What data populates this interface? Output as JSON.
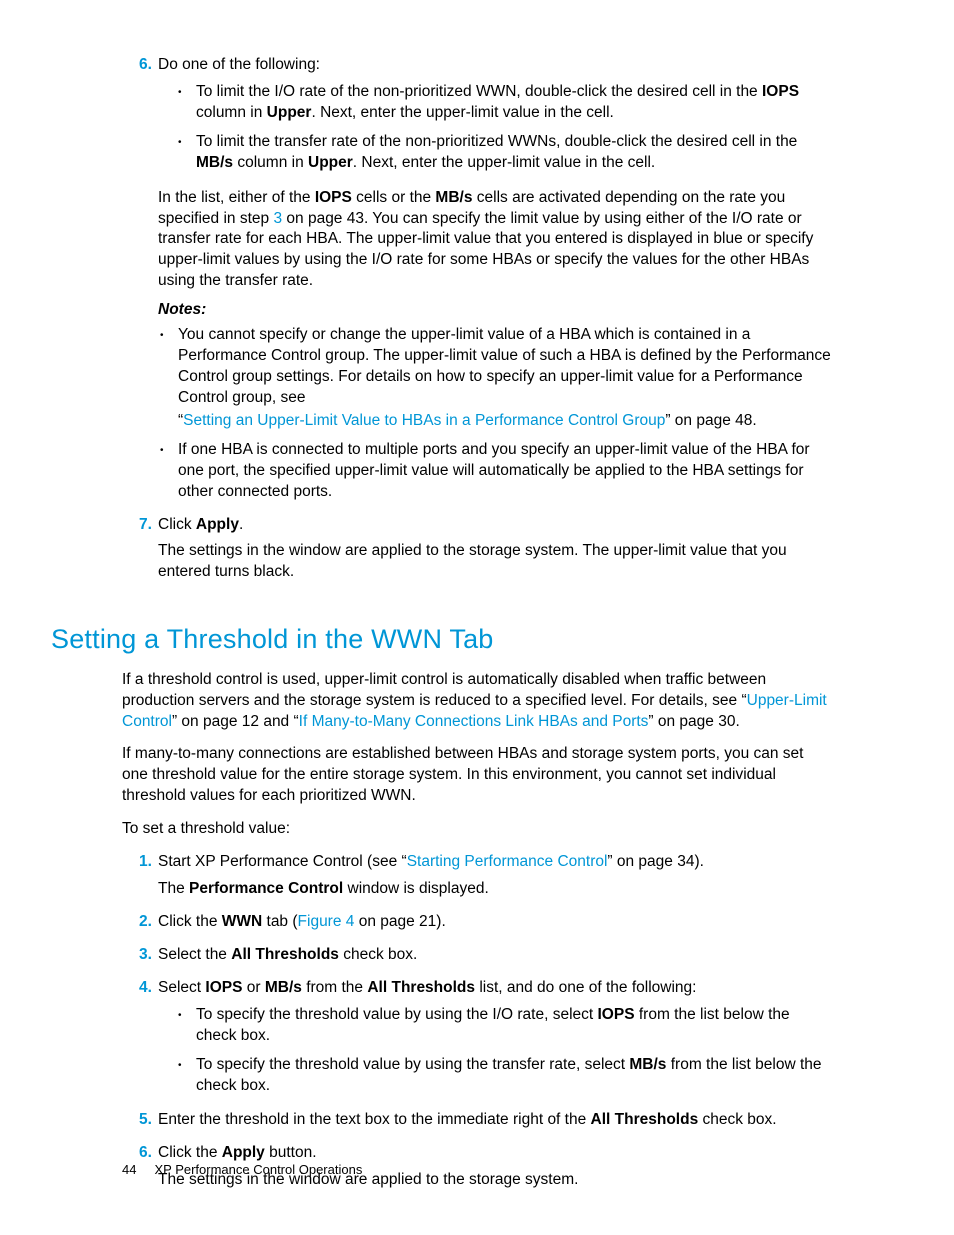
{
  "steps_top": {
    "s6": {
      "num": "6.",
      "lead": "Do one of the following:",
      "b1_a": "To limit the I/O rate of the non-prioritized WWN, double-click the desired cell in the ",
      "b1_b": "IOPS",
      "b1_c": " column in ",
      "b1_d": "Upper",
      "b1_e": ". Next, enter the upper-limit value in the cell.",
      "b2_a": "To limit the transfer rate of the non-prioritized WWNs, double-click the desired cell in the ",
      "b2_b": "MB/s",
      "b2_c": " column in ",
      "b2_d": "Upper",
      "b2_e": ". Next, enter the upper-limit value in the cell."
    },
    "para1_a": "In the list, either of the ",
    "para1_b": "IOPS",
    "para1_c": " cells or the ",
    "para1_d": "MB/s",
    "para1_e": " cells are activated depending on the rate you specified in step ",
    "para1_link": "3",
    "para1_f": " on page 43. You can specify the limit value by using either of the I/O rate or transfer rate for each HBA. The upper-limit value that you entered is displayed in blue or specify upper-limit values by using the I/O rate for some HBAs or specify the values for the other HBAs using the transfer rate.",
    "notes_label": "Notes:",
    "note1_a": "You cannot specify or change the upper-limit value of a HBA which is contained in a Performance Control group. The upper-limit value of such a HBA is defined by the Performance Control group settings. For details on how to specify an upper-limit value for a Performance Control group, see",
    "note1_quote1": "“",
    "note1_link": "Setting an Upper-Limit Value to HBAs in a Performance Control Group",
    "note1_quote2": "” on page 48.",
    "note2": "If one HBA is connected to multiple ports and you specify an upper-limit value of the HBA for one port, the specified upper-limit value will automatically be applied to the HBA settings for other connected ports.",
    "s7": {
      "num": "7.",
      "a": "Click ",
      "b": "Apply",
      "c": ".",
      "d": "The settings in the window are applied to the storage system. The upper-limit value that you entered turns black."
    }
  },
  "section_title": "Setting a Threshold in the WWN Tab",
  "sec": {
    "p1_a": "If a threshold control is used, upper-limit control is automatically disabled when traffic between production servers and the storage system is reduced to a specified level. For details, see “",
    "p1_link1": "Upper-Limit Control",
    "p1_b": "” on page 12 and “",
    "p1_link2": "If Many-to-Many Connections Link HBAs and Ports",
    "p1_c": "” on page 30.",
    "p2": "If many-to-many connections are established between HBAs and storage system ports, you can set one threshold value for the entire storage system. In this environment, you cannot set individual threshold values for each prioritized WWN.",
    "p3": "To set a threshold value:",
    "s1": {
      "num": "1.",
      "a": "Start XP Performance Control (see “",
      "link": "Starting Performance Control",
      "b": "” on page 34).",
      "c": "The ",
      "d": "Performance Control",
      "e": " window is displayed."
    },
    "s2": {
      "num": "2.",
      "a": "Click the ",
      "b": "WWN",
      "c": " tab (",
      "link": "Figure 4",
      "d": " on page 21)."
    },
    "s3": {
      "num": "3.",
      "a": "Select the ",
      "b": "All Thresholds",
      "c": " check box."
    },
    "s4": {
      "num": "4.",
      "a": "Select ",
      "b": "IOPS",
      "c": " or ",
      "d": "MB/s",
      "e": " from the ",
      "f": "All Thresholds",
      "g": " list, and do one of the following:",
      "b1_a": "To specify the threshold value by using the I/O rate, select ",
      "b1_b": "IOPS",
      "b1_c": " from the list below the check box.",
      "b2_a": "To specify the threshold value by using the transfer rate, select ",
      "b2_b": "MB/s",
      "b2_c": " from the list below the check box."
    },
    "s5": {
      "num": "5.",
      "a": "Enter the threshold in the text box to the immediate right of the ",
      "b": "All Thresholds",
      "c": " check box."
    },
    "s6": {
      "num": "6.",
      "a": "Click the ",
      "b": "Apply",
      "c": " button.",
      "d": "The settings in the window are applied to the storage system."
    }
  },
  "footer": {
    "page": "44",
    "title": "XP Performance Control Operations"
  },
  "bullets": {
    "dot": "•"
  }
}
